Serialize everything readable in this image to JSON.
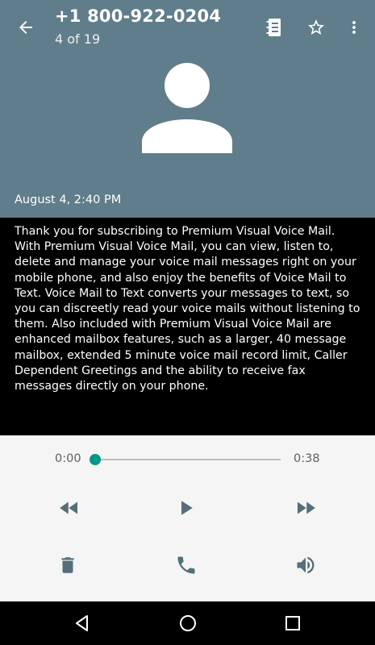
{
  "header": {
    "phone_number": "+1 800-922-0204",
    "position": "4 of 19",
    "date": "August 4, 2:40 PM",
    "background_color": "#607d8b",
    "icons": [
      "back-arrow-icon",
      "contact-card-icon",
      "star-outline-icon",
      "more-vert-icon",
      "person-avatar-icon"
    ]
  },
  "transcript": {
    "text": "Thank you for subscribing to Premium Visual Voice Mail. With Premium Visual Voice Mail, you can view, listen to, delete and manage your voice mail messages right on your mobile phone, and also enjoy the benefits of Voice Mail to Text. Voice Mail to Text converts your messages to text, so you can discreetly read your voice mails without listening to them. Also included with Premium Visual Voice Mail are enhanced mailbox features, such as a larger, 40 message mailbox, extended 5 minute voice mail record limit, Caller Dependent Greetings and the ability to receive fax messages directly on your phone."
  },
  "player": {
    "current_time": "0:00",
    "duration": "0:38",
    "progress_fraction": 0,
    "accent_color": "#009688",
    "icons": [
      "rewind-icon",
      "play-icon",
      "fast-forward-icon",
      "delete-icon",
      "phone-icon",
      "speaker-icon"
    ]
  },
  "navbar": {
    "icons": [
      "nav-back-icon",
      "nav-home-icon",
      "nav-recents-icon"
    ]
  }
}
